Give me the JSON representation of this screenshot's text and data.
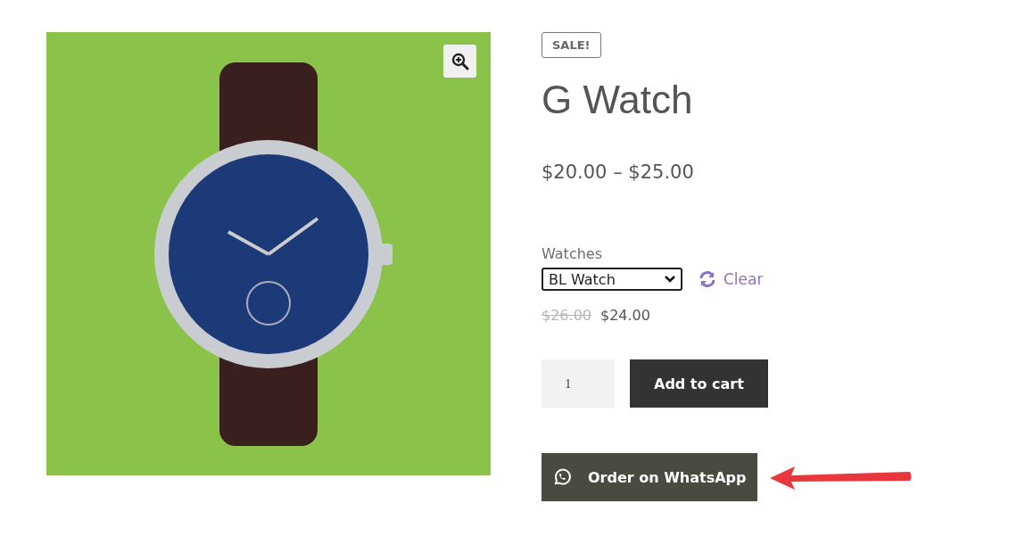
{
  "product": {
    "badge": "SALE!",
    "title": "G Watch",
    "price_range": "$20.00 – $25.00",
    "variation": {
      "label": "Watches",
      "value": "BL Watch",
      "clear": "Clear"
    },
    "variation_price": {
      "old": "$26.00",
      "new": "$24.00"
    },
    "quantity": "1",
    "add_to_cart": "Add to cart",
    "whatsapp_button": "Order on WhatsApp"
  }
}
